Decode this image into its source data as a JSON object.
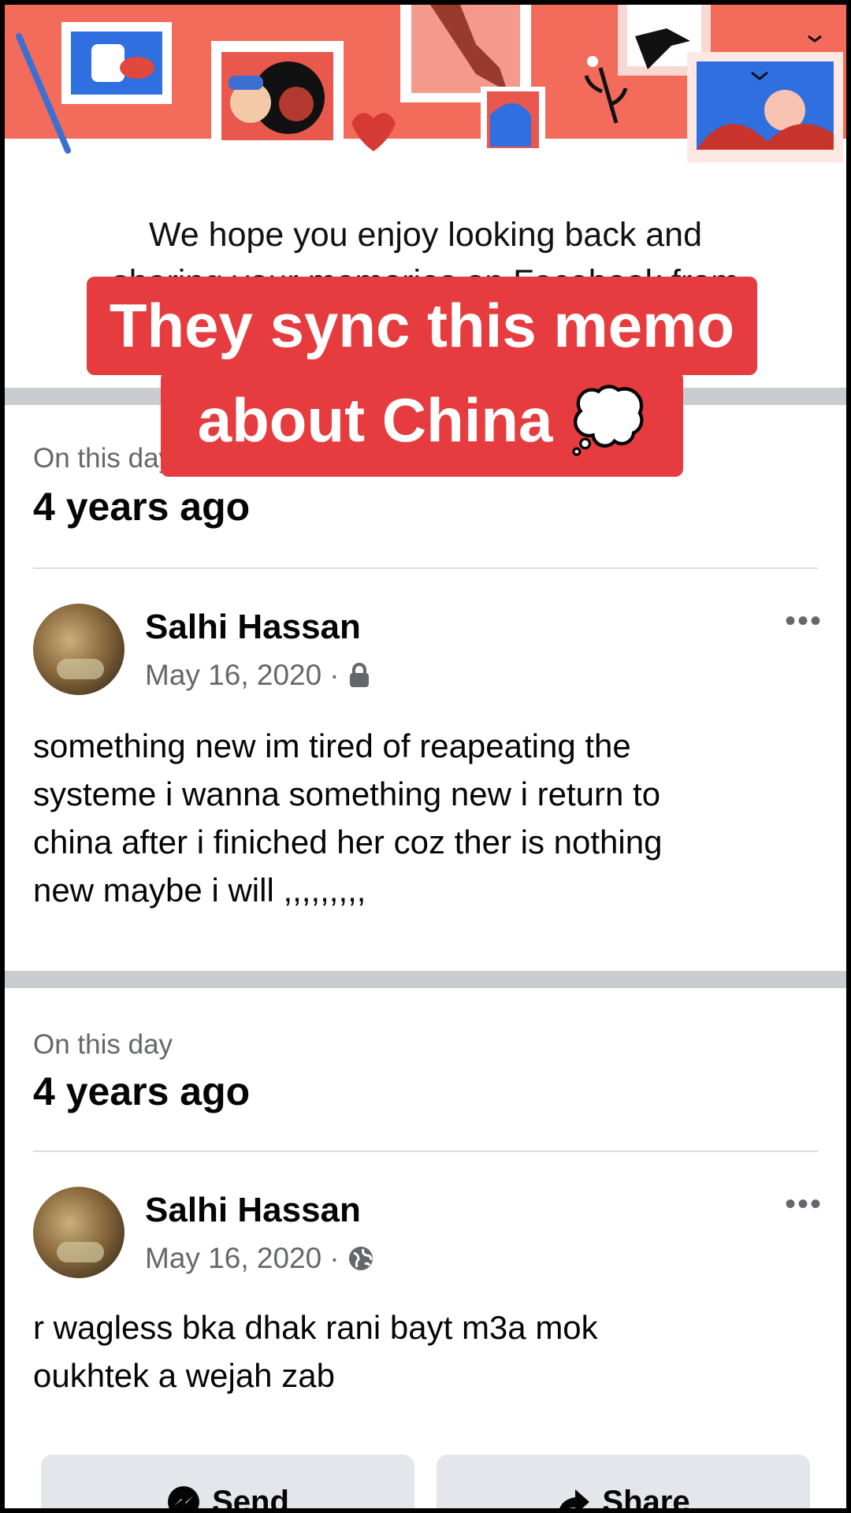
{
  "intro": {
    "line1": "We hope you enjoy looking back and",
    "line2": "sharing your memories on Facebook from"
  },
  "caption": {
    "line1": "They sync this memo",
    "line2": "about China 💭"
  },
  "memories": [
    {
      "label": "On this day",
      "title": "4 years ago",
      "author": "Salhi Hassan",
      "date": "May 16, 2020",
      "separator": "·",
      "privacy_icon": "lock-icon",
      "more": "•••",
      "text_lines": [
        "something new im  tired of reapeating the",
        "systeme i wanna something new i return to",
        "china after i finiched her coz ther is nothing",
        "new maybe i will ,,,,,,,,,"
      ]
    },
    {
      "label": "On this day",
      "title": "4 years ago",
      "author": "Salhi Hassan",
      "date": "May 16, 2020",
      "separator": "·",
      "privacy_icon": "globe-icon",
      "more": "•••",
      "text_lines": [
        "r wagless  bka  dhak rani bayt m3a mok",
        "oukhtek a wejah zab"
      ]
    }
  ],
  "actions": {
    "send_label": "Send",
    "share_label": "Share"
  },
  "colors": {
    "banner": "#f26b5b",
    "caption_bg": "#e63c3f",
    "divider": "#c9ccd1",
    "secondary_text": "#65676b"
  }
}
